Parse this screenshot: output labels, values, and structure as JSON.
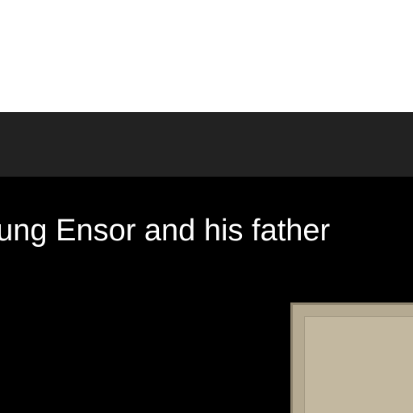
{
  "caption": {
    "text": "oung Ensor and his father"
  },
  "colors": {
    "top_background": "#ffffff",
    "header_bar": "#222222",
    "content_background": "#000000",
    "caption_text": "#ffffff",
    "photo_mat": "#b5aa92"
  }
}
